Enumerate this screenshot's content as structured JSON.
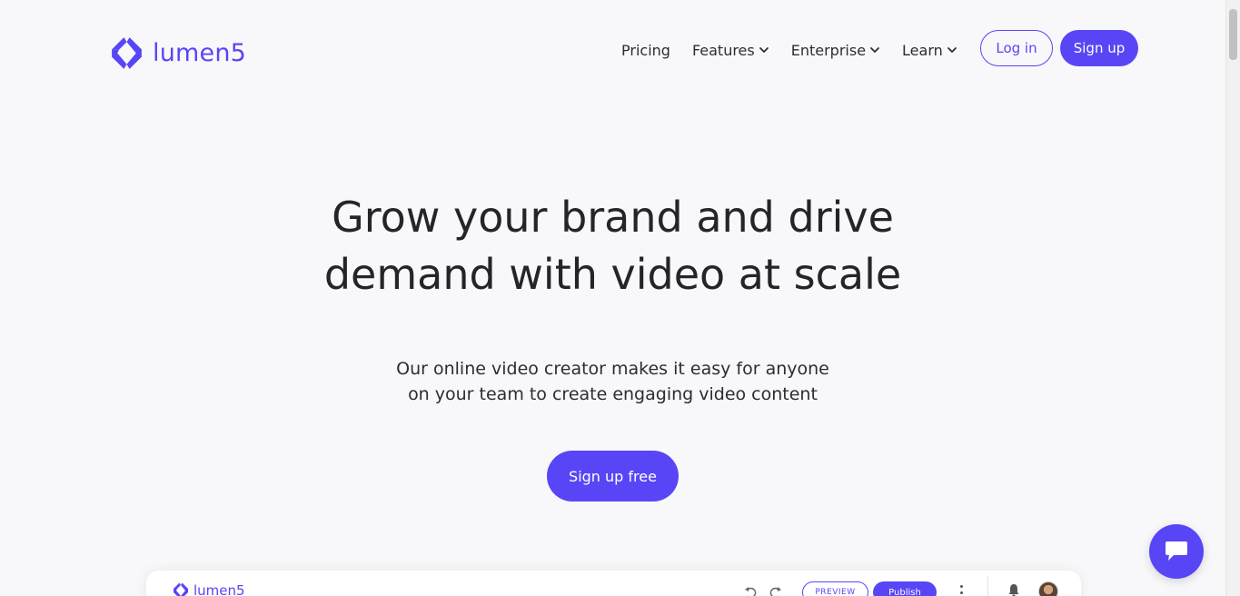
{
  "brand": {
    "name": "lumen5",
    "accent": "#5846f6"
  },
  "nav": {
    "items": [
      {
        "label": "Pricing",
        "dropdown": false
      },
      {
        "label": "Features",
        "dropdown": true
      },
      {
        "label": "Enterprise",
        "dropdown": true
      },
      {
        "label": "Learn",
        "dropdown": true
      }
    ],
    "login_label": "Log in",
    "signup_label": "Sign up"
  },
  "hero": {
    "title_line1": "Grow your brand and drive",
    "title_line2": "demand with video at scale",
    "sub_line1": "Our online video creator makes it easy for anyone",
    "sub_line2": "on your team to create engaging video content",
    "cta_label": "Sign up free"
  },
  "app_preview": {
    "logo_text": "lumen5",
    "preview_label": "PREVIEW",
    "publish_label": "Publish"
  },
  "chat": {
    "icon": "chat-bubble-icon"
  }
}
